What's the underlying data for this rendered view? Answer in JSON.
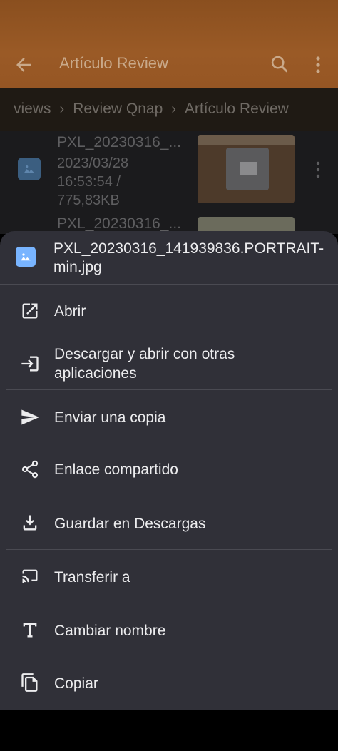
{
  "app_bar": {
    "title": "Artículo Review",
    "back_icon": "arrow-left-icon",
    "search_icon": "search-icon",
    "more_icon": "more-vert-icon",
    "color": "#8a4f1f"
  },
  "breadcrumb": {
    "items": [
      "views",
      "Review Qnap",
      "Artículo Review"
    ],
    "separator": ">"
  },
  "files": [
    {
      "name": "PXL_20230316_...",
      "date": "2023/03/28",
      "time": "16:53:54 /",
      "size": "775,83KB"
    },
    {
      "name": "PXL_20230316_..."
    }
  ],
  "sheet": {
    "file_name": "PXL_20230316_141939836.PORTRAIT-min.jpg",
    "actions": [
      {
        "label": "Abrir",
        "icon": "open-in-new-icon"
      },
      {
        "label": "Descargar y abrir con otras aplicaciones",
        "icon": "login-arrow-icon"
      },
      {
        "label": "Enviar una copia",
        "icon": "send-icon"
      },
      {
        "label": "Enlace compartido",
        "icon": "share-icon"
      },
      {
        "label": "Guardar en Descargas",
        "icon": "download-icon"
      },
      {
        "label": "Transferir a",
        "icon": "cast-icon"
      },
      {
        "label": "Cambiar nombre",
        "icon": "text-rename-icon"
      },
      {
        "label": "Copiar",
        "icon": "copy-icon"
      }
    ],
    "background": "#303038",
    "accent": "#78b4ff"
  }
}
